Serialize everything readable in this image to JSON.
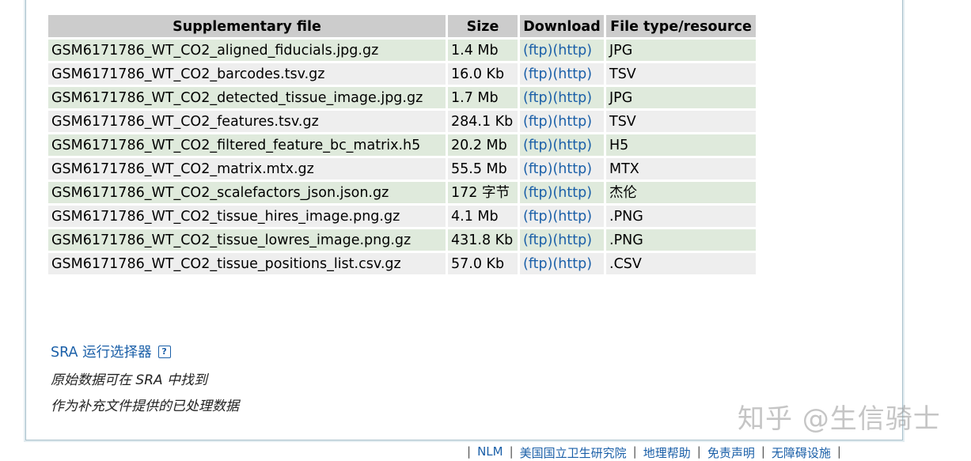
{
  "table": {
    "headers": [
      "Supplementary file",
      "Size",
      "Download",
      "File type/resource"
    ],
    "rows": [
      {
        "file": "GSM6171786_WT_CO2_aligned_fiducials.jpg.gz",
        "size": "1.4 Mb",
        "ftp": "(ftp)",
        "http": "(http)",
        "type": "JPG"
      },
      {
        "file": "GSM6171786_WT_CO2_barcodes.tsv.gz",
        "size": "16.0 Kb",
        "ftp": "(ftp)",
        "http": "(http)",
        "type": "TSV"
      },
      {
        "file": "GSM6171786_WT_CO2_detected_tissue_image.jpg.gz",
        "size": "1.7 Mb",
        "ftp": "(ftp)",
        "http": "(http)",
        "type": "JPG"
      },
      {
        "file": "GSM6171786_WT_CO2_features.tsv.gz",
        "size": "284.1 Kb",
        "ftp": "(ftp)",
        "http": "(http)",
        "type": "TSV"
      },
      {
        "file": "GSM6171786_WT_CO2_filtered_feature_bc_matrix.h5",
        "size": "20.2 Mb",
        "ftp": "(ftp)",
        "http": "(http)",
        "type": "H5"
      },
      {
        "file": "GSM6171786_WT_CO2_matrix.mtx.gz",
        "size": "55.5 Mb",
        "ftp": "(ftp)",
        "http": "(http)",
        "type": "MTX"
      },
      {
        "file": "GSM6171786_WT_CO2_scalefactors_json.json.gz",
        "size": "172 字节",
        "ftp": "(ftp)",
        "http": "(http)",
        "type": "杰伦"
      },
      {
        "file": "GSM6171786_WT_CO2_tissue_hires_image.png.gz",
        "size": "4.1 Mb",
        "ftp": "(ftp)",
        "http": "(http)",
        "type": ".PNG"
      },
      {
        "file": "GSM6171786_WT_CO2_tissue_lowres_image.png.gz",
        "size": "431.8 Kb",
        "ftp": "(ftp)",
        "http": "(http)",
        "type": ".PNG"
      },
      {
        "file": "GSM6171786_WT_CO2_tissue_positions_list.csv.gz",
        "size": "57.0 Kb",
        "ftp": "(ftp)",
        "http": "(http)",
        "type": ".CSV"
      }
    ]
  },
  "sra_link": "SRA 运行选择器",
  "help_icon": "?",
  "notes": [
    "原始数据可在 SRA 中找到",
    "作为补充文件提供的已处理数据"
  ],
  "footer": [
    "NLM",
    "美国国立卫生研究院",
    "地理帮助",
    "免责声明",
    "无障碍设施"
  ],
  "watermark": "知乎 @生信骑士",
  "colors": {
    "link": "#1a5fa8",
    "header_bg": "#cccccc",
    "row_even": "#dfeadc",
    "row_odd": "#eeeeee"
  }
}
